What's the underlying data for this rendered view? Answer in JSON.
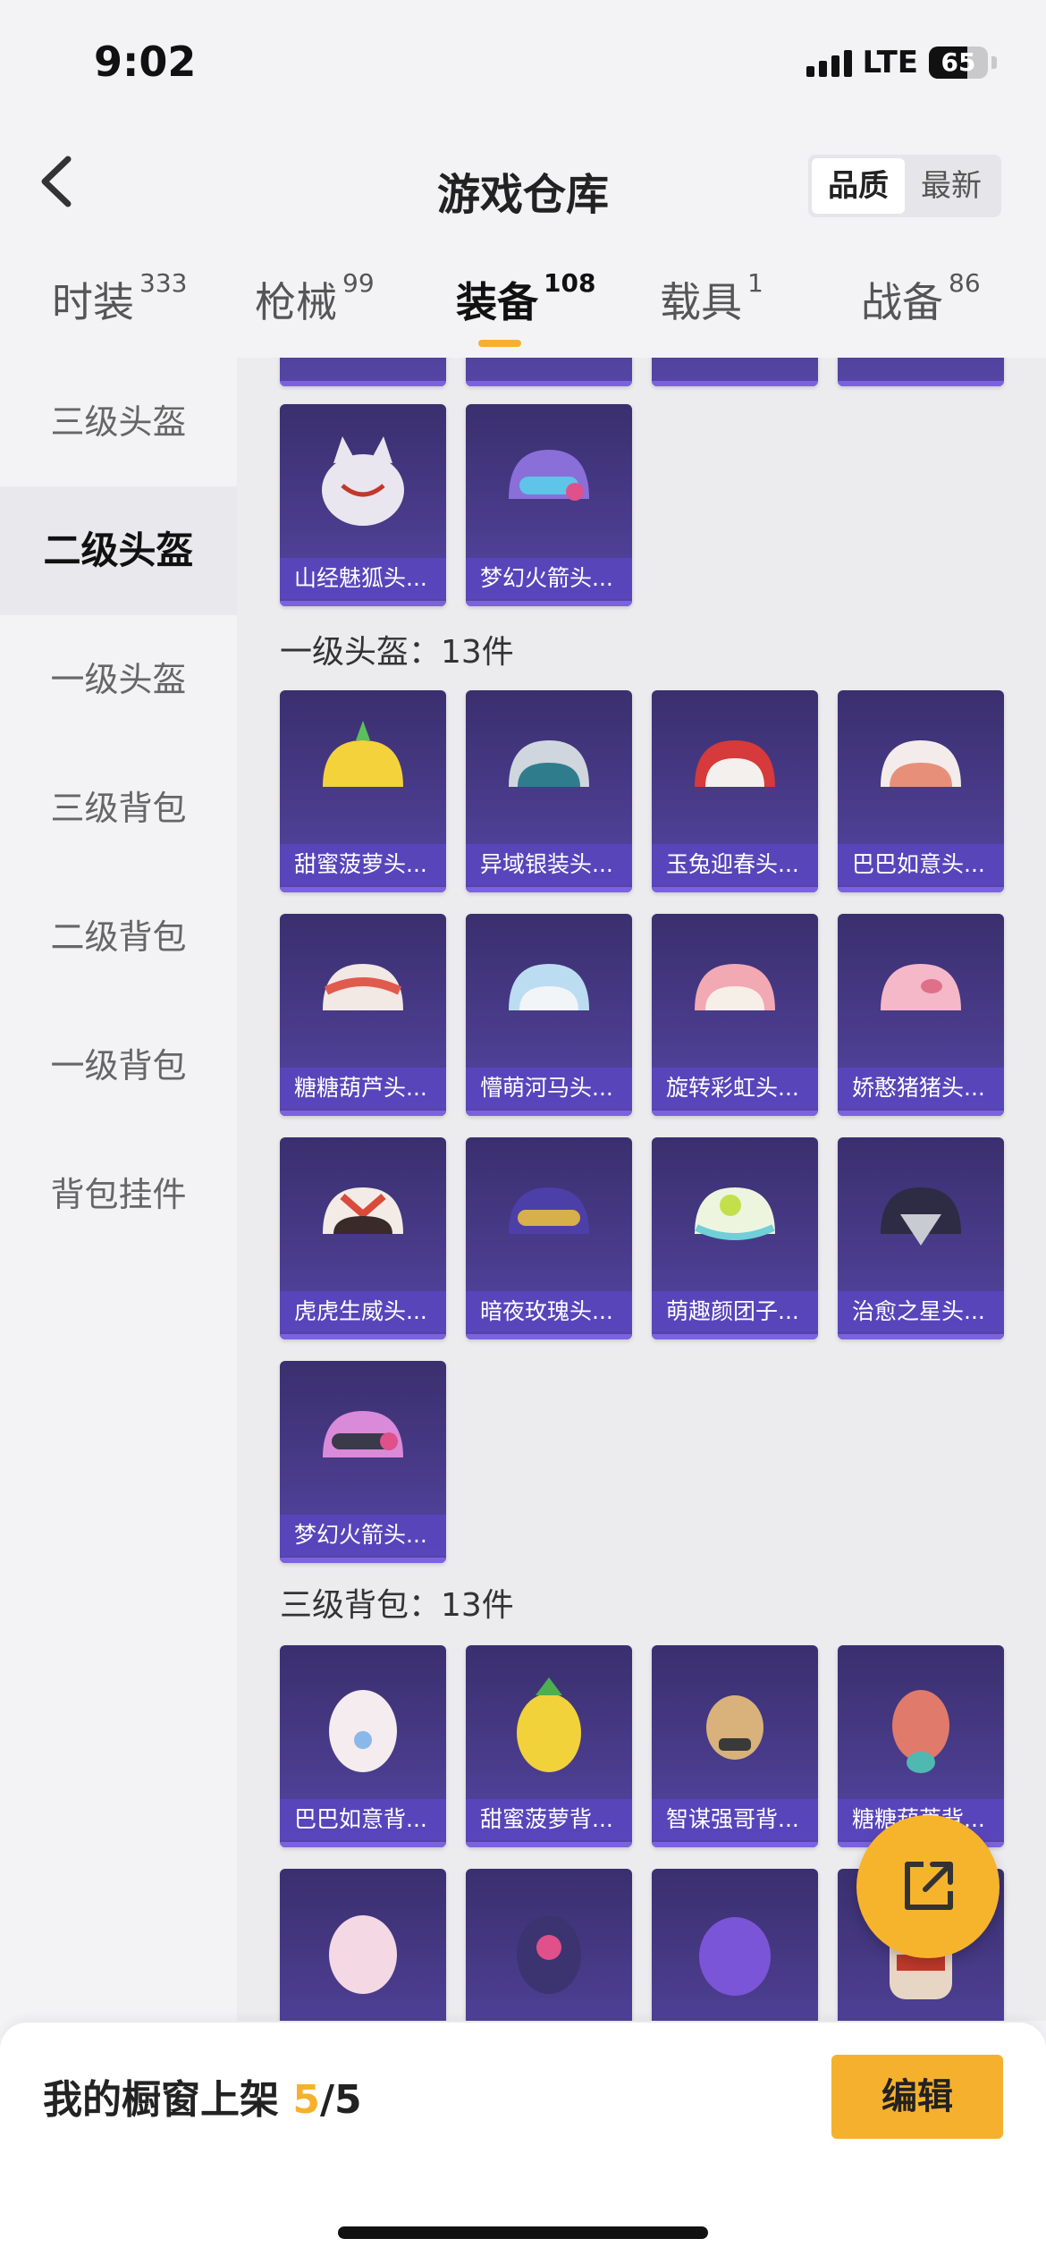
{
  "status": {
    "time": "9:02",
    "network": "LTE",
    "battery": "65"
  },
  "header": {
    "title": "游戏仓库",
    "sort_options": [
      "品质",
      "最新"
    ]
  },
  "tabs": [
    {
      "label": "时装",
      "count": "333"
    },
    {
      "label": "枪械",
      "count": "99"
    },
    {
      "label": "装备",
      "count": "108"
    },
    {
      "label": "载具",
      "count": "1"
    },
    {
      "label": "战备",
      "count": "86"
    }
  ],
  "sidebar": [
    "三级头盔",
    "二级头盔",
    "一级头盔",
    "三级背包",
    "二级背包",
    "一级背包",
    "背包挂件"
  ],
  "sections": {
    "level2_helmets": {
      "items": [
        "山经魅狐头...",
        "梦幻火箭头..."
      ]
    },
    "level1_helmets": {
      "title": "一级头盔：13件",
      "items": [
        "甜蜜菠萝头...",
        "异域银装头...",
        "玉兔迎春头...",
        "巴巴如意头...",
        "糖糖葫芦头...",
        "懵萌河马头...",
        "旋转彩虹头...",
        "娇憨猪猪头...",
        "虎虎生威头...",
        "暗夜玫瑰头...",
        "萌趣颜团子...",
        "治愈之星头...",
        "梦幻火箭头..."
      ]
    },
    "level3_backpacks": {
      "title": "三级背包：13件",
      "items": [
        "巴巴如意背...",
        "甜蜜菠萝背...",
        "智谋强哥背...",
        "糖糖葫芦背..."
      ]
    }
  },
  "bottom_bar": {
    "label": "我的橱窗上架",
    "count": "5",
    "total": "/5",
    "edit_label": "编辑"
  },
  "colors": {
    "accent": "#f5b12d",
    "card_bg": "#3a2f6e",
    "card_label_bg": "#5a46be"
  }
}
